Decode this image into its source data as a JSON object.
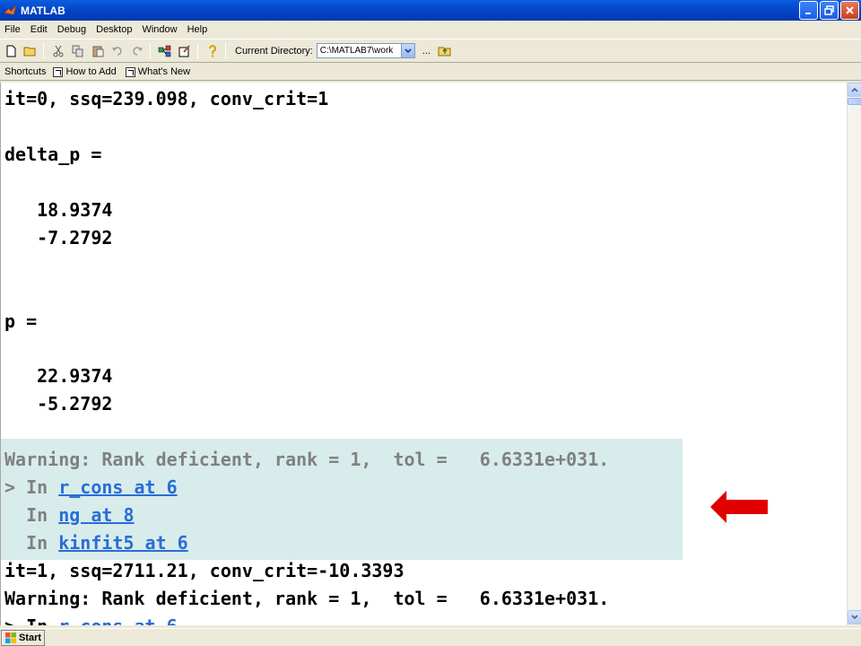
{
  "window": {
    "title": "MATLAB"
  },
  "menu": [
    "File",
    "Edit",
    "Debug",
    "Desktop",
    "Window",
    "Help"
  ],
  "toolbar": {
    "current_directory_label": "Current Directory:",
    "current_directory_value": "C:\\MATLAB7\\work",
    "browse_label": "..."
  },
  "shortcuts": {
    "label": "Shortcuts",
    "items": [
      "How to Add",
      "What's New"
    ]
  },
  "console": {
    "line_it0": "it=0, ssq=239.098, conv_crit=1",
    "line_delta_p": "delta_p =",
    "delta_p_1": "   18.9374",
    "delta_p_2": "   -7.2792",
    "line_p": "p =",
    "p_1": "   22.9374",
    "p_2": "   -5.2792",
    "warning_text": "Warning: Rank deficient, rank = 1,  tol =   6.6331e+031.",
    "trace_1_prefix": "> In ",
    "trace_1_link": "r_cons at 6",
    "trace_2_prefix": "  In ",
    "trace_2_link": "ng at 8",
    "trace_3_prefix": "  In ",
    "trace_3_link": "kinfit5 at 6",
    "line_it1": "it=1, ssq=2711.21, conv_crit=-10.3393",
    "warning_text_2": "Warning: Rank deficient, rank = 1,  tol =   6.6331e+031.",
    "trace_4_prefix": "> In ",
    "trace_4_link": "r_cons at 6"
  },
  "colors": {
    "highlight_bg": "#d8ecec",
    "warning_gray": "#808080",
    "link_blue": "#2a6dd6",
    "arrow_red": "#e00000"
  },
  "taskbar": {
    "start_label": "Start"
  }
}
